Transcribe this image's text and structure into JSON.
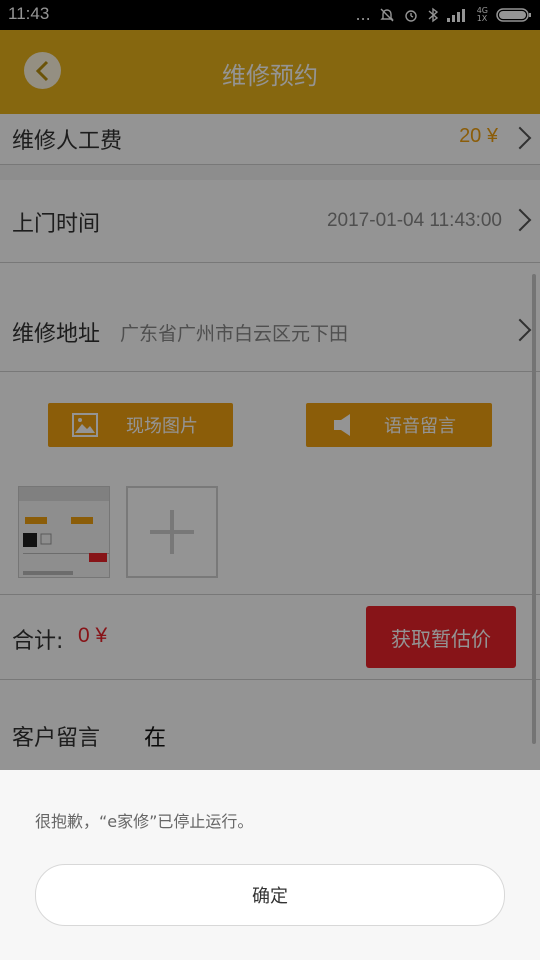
{
  "status_bar": {
    "time": "11:43",
    "dots": "...",
    "network_top": "4G",
    "network_bottom": "1X"
  },
  "app_bar": {
    "title": "维修预约"
  },
  "fields": {
    "labor_fee": {
      "label": "维修人工费",
      "value": "20 ¥"
    },
    "visit_time": {
      "label": "上门时间",
      "value": "2017-01-04 11:43:00"
    },
    "address": {
      "label": "维修地址",
      "value": "广东省广州市白云区元下田"
    }
  },
  "buttons": {
    "photos": "现场图片",
    "voice": "语音留言",
    "estimate": "获取暂估价"
  },
  "total": {
    "label": "合计:",
    "value": "0 ¥"
  },
  "customer_message": {
    "label": "客户留言",
    "value": "在"
  },
  "dialog": {
    "message": "很抱歉，“e家修”已停止运行。",
    "ok_label": "确定"
  },
  "colors": {
    "brand": "#e7b21a",
    "accent_orange": "#f0a010",
    "danger_red": "#e8232a"
  },
  "icons": [
    "back-arrow-icon",
    "chevron-right-icon",
    "image-icon",
    "speaker-icon",
    "plus-icon"
  ]
}
